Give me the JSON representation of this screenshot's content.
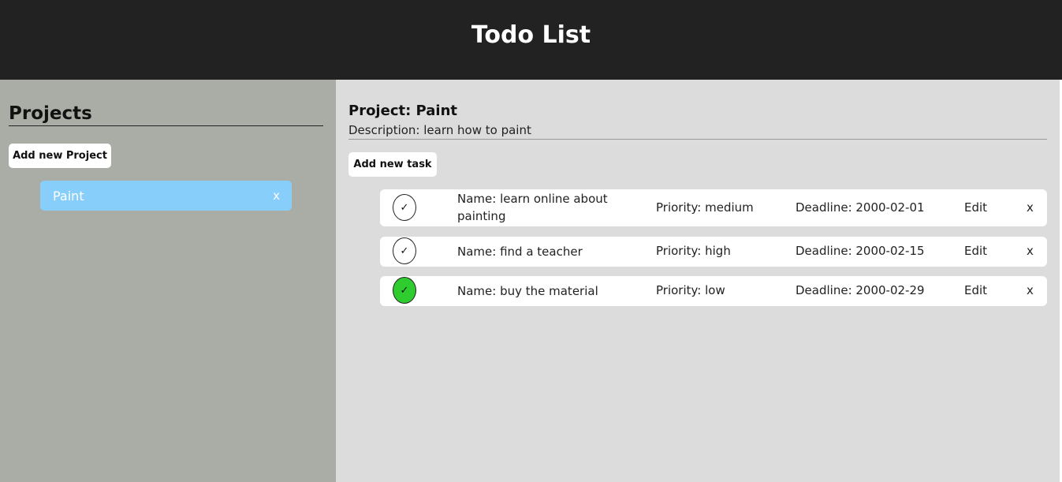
{
  "header": {
    "title": "Todo List"
  },
  "sidebar": {
    "title": "Projects",
    "add_project_label": "Add new Project",
    "projects": [
      {
        "name": "Paint",
        "delete_label": "x",
        "color": "#87cefa"
      }
    ]
  },
  "main": {
    "project_name": "Project: Paint",
    "description": "Description: learn how to paint",
    "add_task_label": "Add new task",
    "tasks": [
      {
        "check": "✓",
        "done": false,
        "name": "Name: learn online about painting",
        "priority": "Priority: medium",
        "deadline": "Deadline: 2000-02-01",
        "edit_label": "Edit",
        "delete_label": "x"
      },
      {
        "check": "✓",
        "done": false,
        "name": "Name: find a teacher",
        "priority": "Priority: high",
        "deadline": "Deadline: 2000-02-15",
        "edit_label": "Edit",
        "delete_label": "x"
      },
      {
        "check": "✓",
        "done": true,
        "name": "Name: buy the material",
        "priority": "Priority: low",
        "deadline": "Deadline: 2000-02-29",
        "edit_label": "Edit",
        "delete_label": "x"
      }
    ]
  },
  "colors": {
    "header_bg": "#222222",
    "sidebar_bg": "#aaada5",
    "main_bg": "#dcdcdc",
    "project_highlight": "#87cefa",
    "done_check": "#2ecc2e"
  }
}
